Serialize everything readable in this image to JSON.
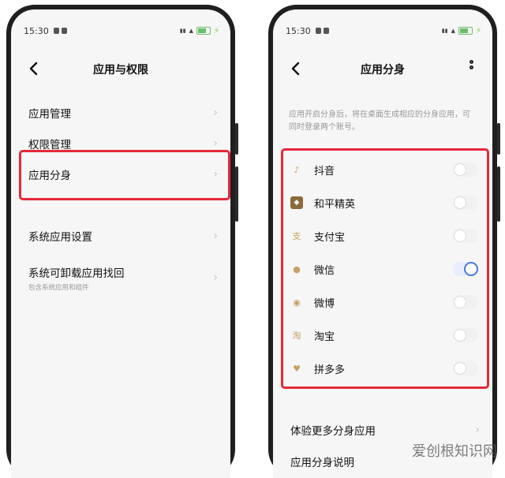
{
  "left_screen": {
    "status": {
      "time": "15:30"
    },
    "title": "应用与权限",
    "items": [
      {
        "label": "应用管理"
      },
      {
        "label": "权限管理"
      },
      {
        "label": "应用分身"
      },
      {
        "label": "系统应用设置"
      },
      {
        "label": "系统可卸载应用找回",
        "sub": "包含系统应用和组件"
      }
    ],
    "highlight_color": "#e5283a"
  },
  "right_screen": {
    "status": {
      "time": "15:30"
    },
    "title": "应用分身",
    "description": "应用开启分身后，将在桌面生成相应的分身应用，可同时登录两个账号。",
    "apps": [
      {
        "name": "抖音",
        "icon": "douyin-icon",
        "enabled": false
      },
      {
        "name": "和平精英",
        "icon": "peace-elite-icon",
        "enabled": false
      },
      {
        "name": "支付宝",
        "icon": "alipay-icon",
        "enabled": false
      },
      {
        "name": "微信",
        "icon": "wechat-icon",
        "enabled": true
      },
      {
        "name": "微博",
        "icon": "weibo-icon",
        "enabled": false
      },
      {
        "name": "淘宝",
        "icon": "taobao-icon",
        "enabled": false
      },
      {
        "name": "拼多多",
        "icon": "pinduoduo-icon",
        "enabled": false
      }
    ],
    "more_apps_label": "体验更多分身应用",
    "explain_label": "应用分身说明",
    "toggle_on_color": "#4a78e0"
  },
  "watermark": "爱创根知识网"
}
